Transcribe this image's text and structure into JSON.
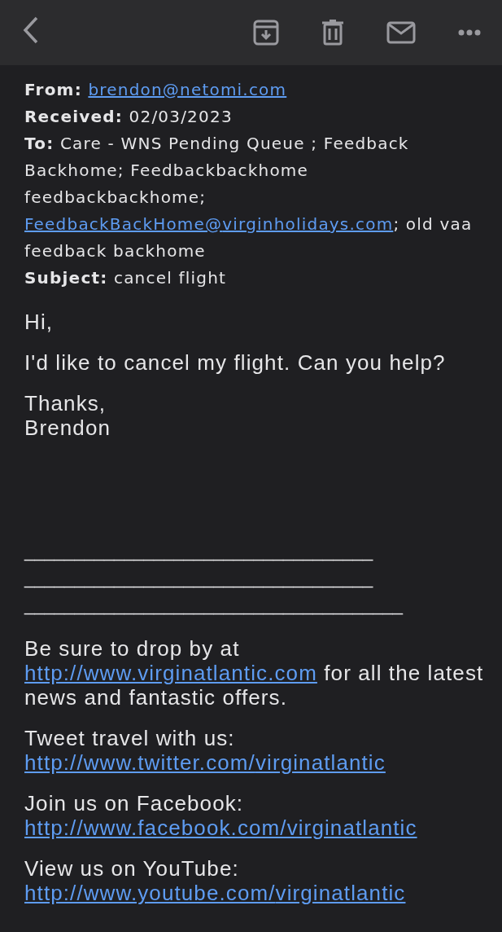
{
  "header": [
    {
      "label": "From:",
      "parts": [
        {
          "kind": "link",
          "text": "brendon@netomi.com"
        }
      ]
    },
    {
      "label": "Received:",
      "parts": [
        {
          "kind": "text",
          "text": "02/03/2023"
        }
      ]
    },
    {
      "label": "To:",
      "parts": [
        {
          "kind": "text",
          "text": "Care - WNS Pending Queue ; Feedback Backhome; Feedbackbackhome feedbackbackhome; "
        },
        {
          "kind": "link",
          "text": "FeedbackBackHome@"
        },
        {
          "kind": "link",
          "text": "virginholidays.com"
        },
        {
          "kind": "text",
          "text": "; old vaa feedback backhome"
        }
      ]
    },
    {
      "label": "Subject:",
      "parts": [
        {
          "kind": "text",
          "text": "cancel flight"
        }
      ]
    }
  ],
  "body": [
    {
      "kind": "text",
      "parts": [
        {
          "kind": "text",
          "text": "Hi,"
        }
      ]
    },
    {
      "kind": "text",
      "parts": [
        {
          "kind": "text",
          "text": "I'd like to cancel my flight. Can you help?"
        }
      ]
    },
    {
      "kind": "text",
      "parts": [
        {
          "kind": "text",
          "text": "Thanks,\nBrendon"
        }
      ]
    },
    {
      "kind": "rules",
      "parts": [
        "___________________________________",
        "___________________________________",
        "______________________________________"
      ]
    },
    {
      "kind": "text",
      "parts": [
        {
          "kind": "text",
          "text": "Be sure to drop by at "
        },
        {
          "kind": "link",
          "text": "http://www.virginatlantic.com"
        },
        {
          "kind": "text",
          "text": " for all the latest news and fantastic offers."
        }
      ]
    },
    {
      "kind": "text",
      "parts": [
        {
          "kind": "text",
          "text": "Tweet travel with us: "
        },
        {
          "kind": "link",
          "text": "http://www.twitter.com/"
        },
        {
          "kind": "link",
          "text": "virginatlantic"
        }
      ]
    },
    {
      "kind": "text",
      "parts": [
        {
          "kind": "text",
          "text": "Join us on Facebook: "
        },
        {
          "kind": "link",
          "text": "http://www.facebook.com/virginatlantic"
        }
      ]
    },
    {
      "kind": "text",
      "parts": [
        {
          "kind": "text",
          "text": "View us on YouTube: "
        },
        {
          "kind": "link",
          "text": "http://www.youtube.com/"
        },
        {
          "kind": "link",
          "text": "virginatlantic"
        }
      ]
    }
  ]
}
